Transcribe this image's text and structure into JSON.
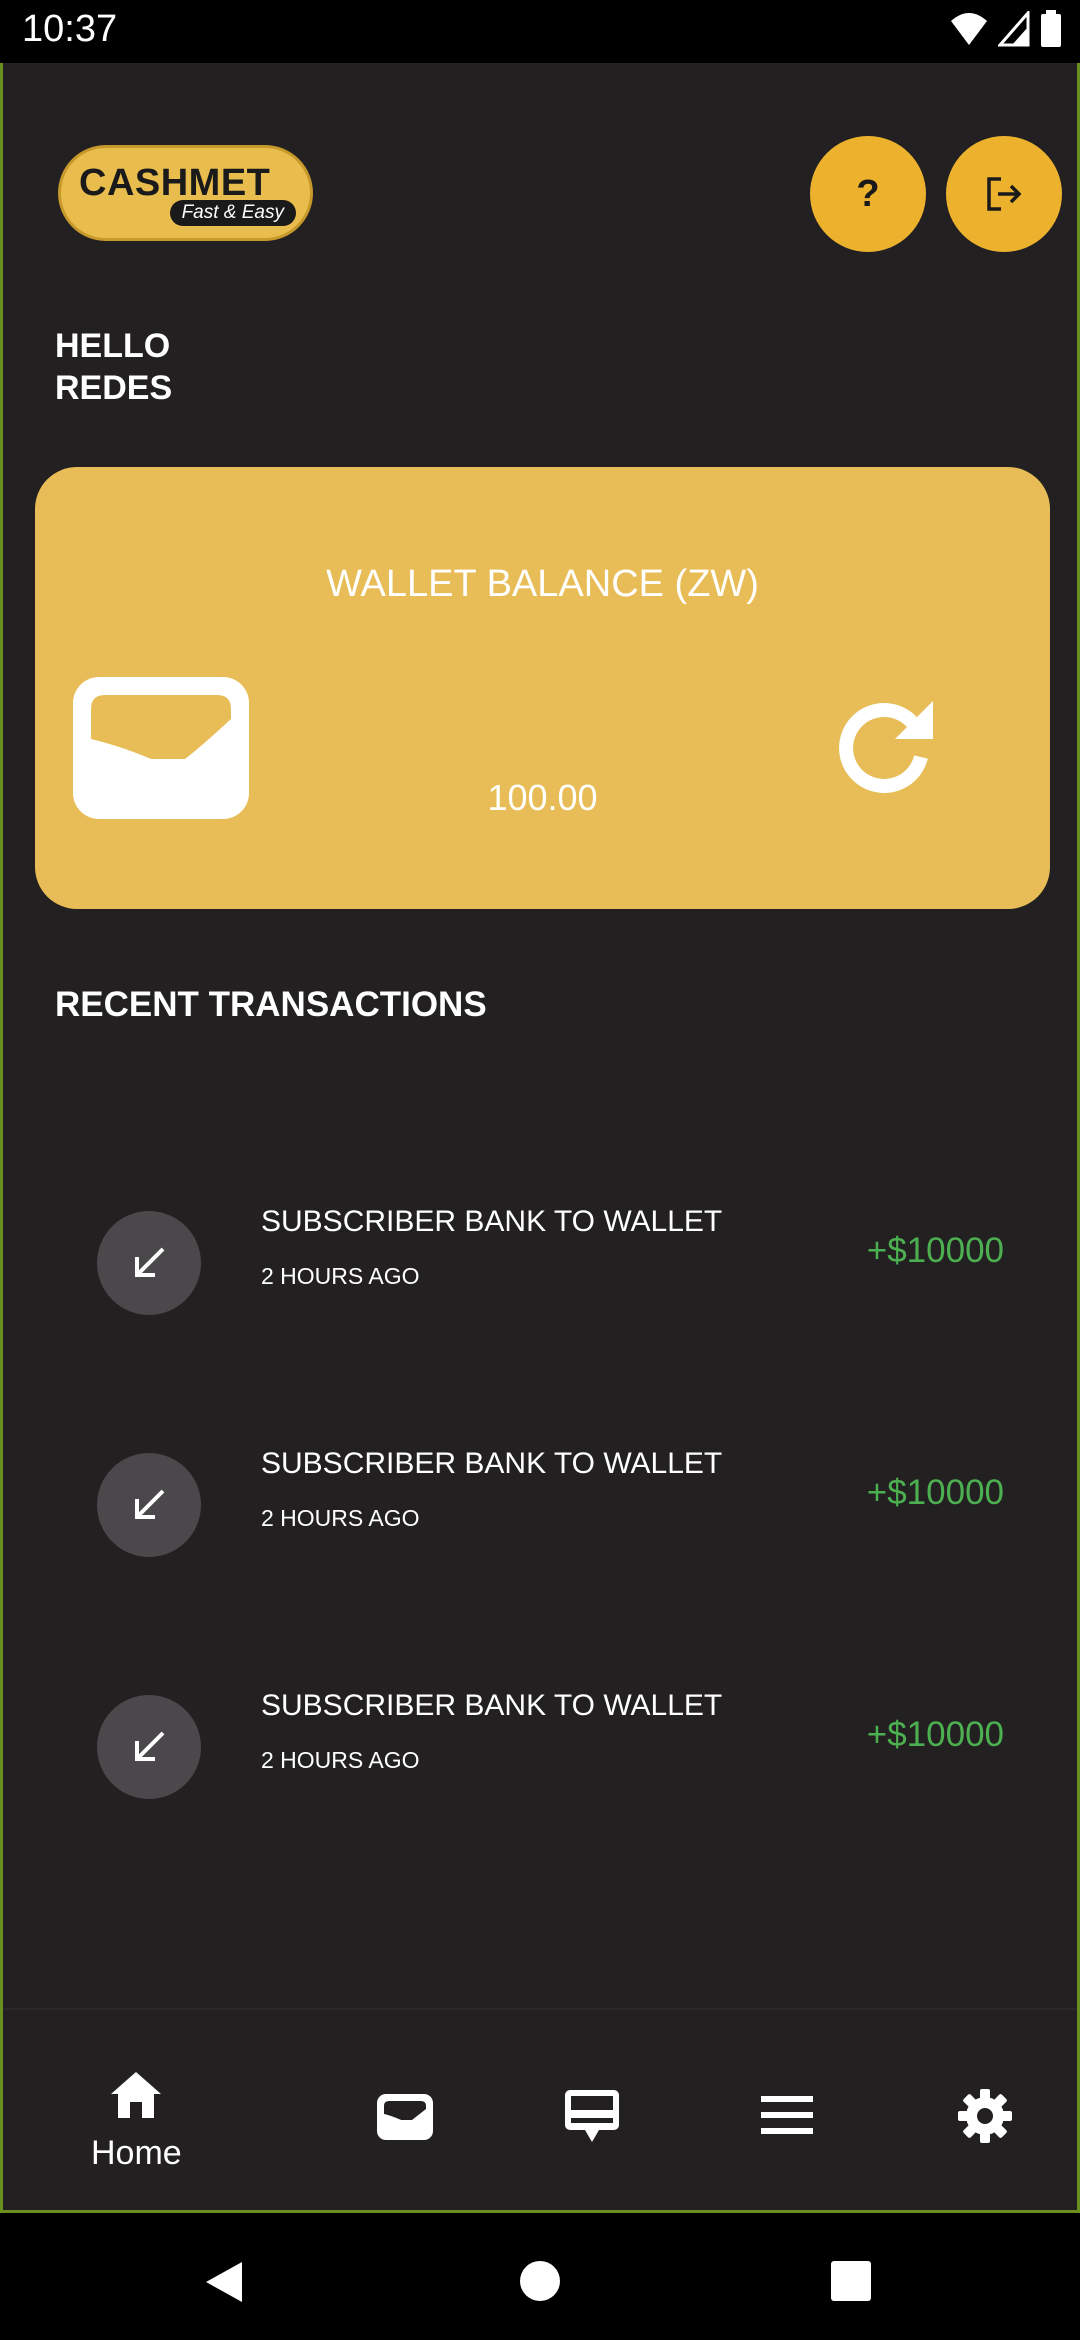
{
  "status_bar": {
    "time": "10:37"
  },
  "app": {
    "logo": {
      "title": "CASHMET",
      "tagline": "Fast & Easy"
    },
    "help_label": "?",
    "greeting": {
      "line1": "HELLO",
      "line2": "REDES"
    }
  },
  "wallet": {
    "title": "WALLET BALANCE (ZW)",
    "amount": "100.00",
    "accent_color": "#e8bd57"
  },
  "transactions": {
    "section_title": "RECENT TRANSACTIONS",
    "items": [
      {
        "title": "SUBSCRIBER BANK TO WALLET",
        "time": "2 HOURS AGO",
        "amount": "+$10000",
        "icon": "arrow-down-left-icon"
      },
      {
        "title": "SUBSCRIBER BANK TO WALLET",
        "time": "2 HOURS AGO",
        "amount": "+$10000",
        "icon": "arrow-down-left-icon"
      },
      {
        "title": "SUBSCRIBER BANK TO WALLET",
        "time": "2 HOURS AGO",
        "amount": "+$10000",
        "icon": "arrow-down-left-icon"
      }
    ],
    "amount_color": "#4caf50"
  },
  "bottom_nav": {
    "items": [
      {
        "label": "Home",
        "icon": "home-icon",
        "active": true
      },
      {
        "label": "",
        "icon": "wallet-icon"
      },
      {
        "label": "",
        "icon": "pos-terminal-icon"
      },
      {
        "label": "",
        "icon": "menu-icon"
      },
      {
        "label": "",
        "icon": "gear-icon"
      }
    ]
  }
}
